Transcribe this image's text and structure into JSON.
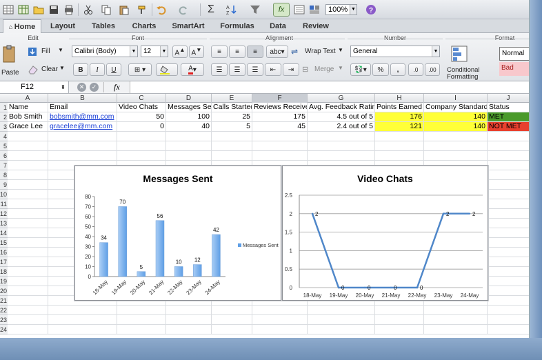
{
  "toolbar": {
    "zoom": "100%"
  },
  "ribbon": {
    "tabs": [
      "Home",
      "Layout",
      "Tables",
      "Charts",
      "SmartArt",
      "Formulas",
      "Data",
      "Review"
    ],
    "groups": {
      "edit": "Edit",
      "font": "Font",
      "alignment": "Alignment",
      "number": "Number",
      "format": "Format"
    },
    "paste_label": "Paste",
    "fill_label": "Fill",
    "clear_label": "Clear",
    "font_name": "Calibri (Body)",
    "font_size": "12",
    "wrap_text_label": "Wrap Text",
    "merge_label": "Merge",
    "number_format": "General",
    "conditional_formatting_line1": "Conditional",
    "conditional_formatting_line2": "Formatting",
    "style_normal": "Normal",
    "style_bad": "Bad",
    "abc_label": "abc"
  },
  "formula_bar": {
    "cell_ref": "F12",
    "fx": "fx"
  },
  "sheet": {
    "columns": [
      "A",
      "B",
      "C",
      "D",
      "E",
      "F",
      "G",
      "H",
      "I",
      "J"
    ],
    "rows": [
      "1",
      "2",
      "3",
      "4",
      "5",
      "6",
      "7",
      "8",
      "9",
      "10",
      "11",
      "12",
      "13",
      "14",
      "15",
      "16",
      "17",
      "18",
      "19",
      "20",
      "21",
      "22",
      "23",
      "24"
    ],
    "header": [
      "Name",
      "Email",
      "Video Chats",
      "Messages Sent",
      "Calls Started",
      "Reviews Received",
      "Avg. Feedback Rating",
      "Points Earned",
      "Company Standard",
      "Status"
    ],
    "data": [
      [
        "Bob Smith",
        "bobsmith@mm.com",
        "50",
        "100",
        "25",
        "175",
        "4.5 out of 5",
        "176",
        "140",
        "MET"
      ],
      [
        "Grace Lee",
        "gracelee@mm.com",
        "0",
        "40",
        "5",
        "45",
        "2.4 out of 5",
        "121",
        "140",
        "NOT MET"
      ]
    ]
  },
  "colors": {
    "met": "#4a9a2b",
    "not_met": "#e8402e",
    "highlight": "#ffff38",
    "bar": "#5f9fe6",
    "line": "#4f87c9"
  },
  "chart_data": [
    {
      "type": "bar",
      "title": "Messages Sent",
      "categories": [
        "18-May",
        "19-May",
        "20-May",
        "21-May",
        "22-May",
        "23-May",
        "24-May"
      ],
      "series": [
        {
          "name": "Messages Sent",
          "values": [
            34,
            70,
            5,
            56,
            10,
            12,
            42
          ]
        }
      ],
      "ylim": [
        0,
        80
      ],
      "yticks": [
        0,
        10,
        20,
        30,
        40,
        50,
        60,
        70,
        80
      ],
      "legend": "right",
      "grid": false
    },
    {
      "type": "line",
      "title": "Video Chats",
      "categories": [
        "18-May",
        "19-May",
        "20-May",
        "21-May",
        "22-May",
        "23-May",
        "24-May"
      ],
      "series": [
        {
          "values": [
            2,
            0,
            0,
            0,
            0,
            2,
            2
          ]
        }
      ],
      "ylim": [
        0,
        2.5
      ],
      "yticks": [
        "0",
        "0.5",
        "1",
        "1.5",
        "2",
        "2.5"
      ],
      "legend": "none",
      "grid": true
    }
  ]
}
